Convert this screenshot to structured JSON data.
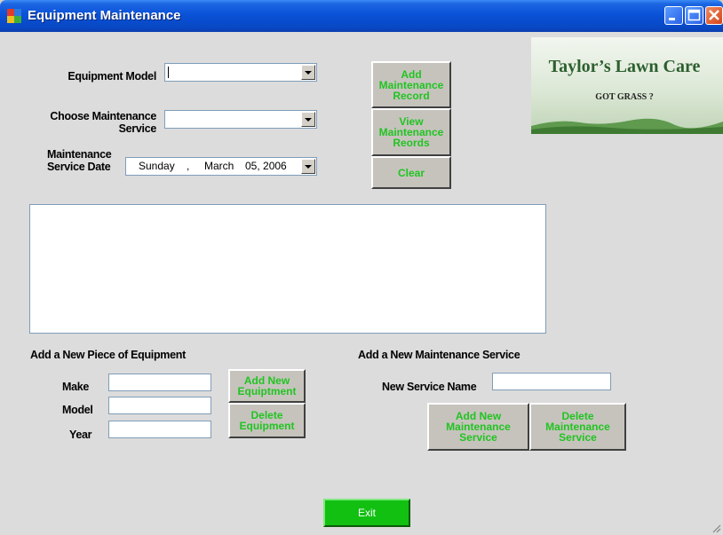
{
  "window": {
    "title": "Equipment Maintenance"
  },
  "form": {
    "equipment_model_label": "Equipment Model",
    "equipment_model_value": "",
    "choose_service_label_1": "Choose Maintenance",
    "choose_service_label_2": "Service",
    "choose_service_value": "",
    "service_date_label_1": "Maintenance",
    "service_date_label_2": "Service Date",
    "date": {
      "day": "Sunday",
      "sep": ",",
      "month": "March",
      "daynum_year": "05, 2006"
    }
  },
  "buttons": {
    "add_record": "Add\nMaintenance\nRecord",
    "view_records": "View\nMaintenance\nReords",
    "clear": "Clear",
    "add_equipment": "Add New\nEquiptment",
    "delete_equipment": "Delete\nEquipment",
    "add_service": "Add New\nMaintenance\nService",
    "delete_service": "Delete\nMaintenance\nService",
    "exit": "Exit"
  },
  "logo": {
    "title": "Taylor’s Lawn Care",
    "subtitle": "GOT GRASS ?"
  },
  "equipment_section": {
    "heading": "Add a New Piece of Equipment",
    "make_label": "Make",
    "make_value": "",
    "model_label": "Model",
    "model_value": "",
    "year_label": "Year",
    "year_value": ""
  },
  "service_section": {
    "heading": "Add a New Maintenance Service",
    "name_label": "New Service Name",
    "name_value": ""
  },
  "colors": {
    "button_text": "#21c421",
    "exit_bg": "#12c012",
    "titlebar": "#0a52d8"
  }
}
